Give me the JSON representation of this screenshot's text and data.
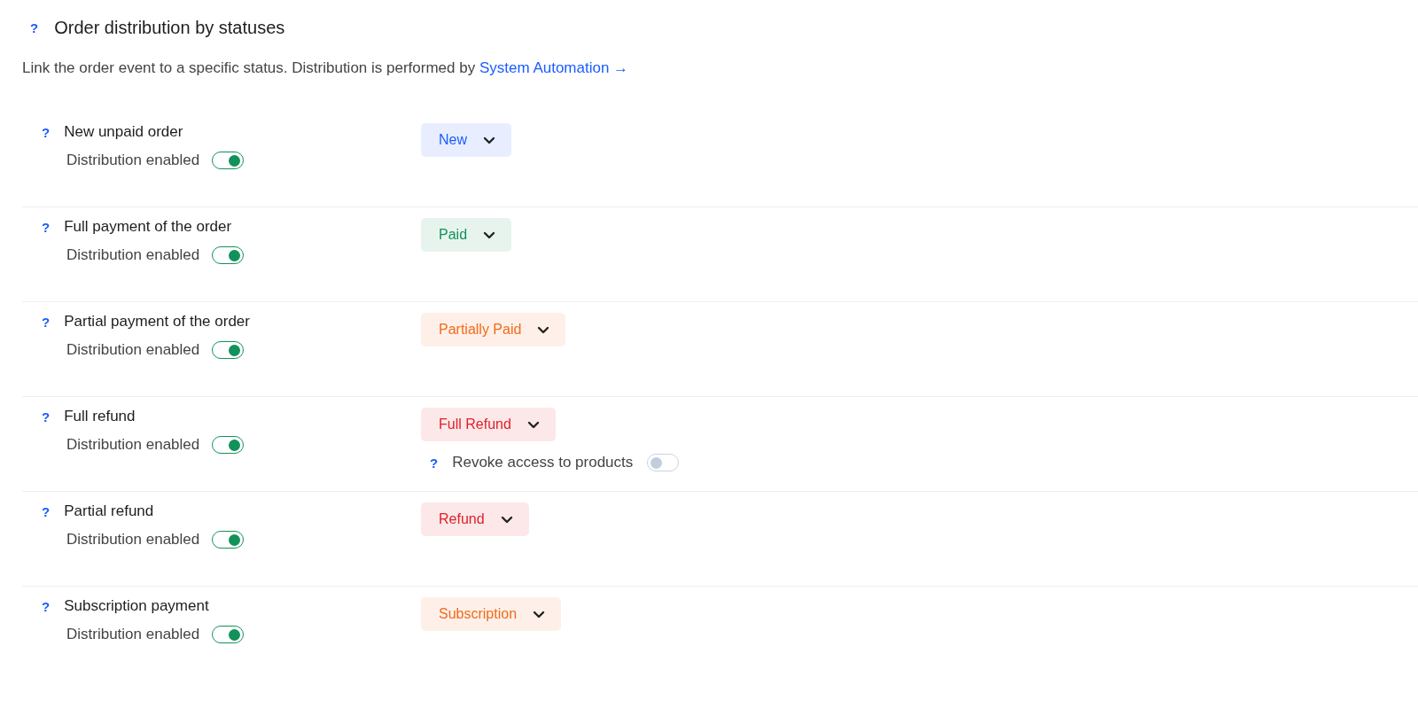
{
  "section": {
    "help": "?",
    "title": "Order distribution by statuses",
    "description": "Link the order event to a specific status. Distribution is performed by ",
    "link": "System Automation →"
  },
  "events": [
    {
      "help": "?",
      "name": "New unpaid order",
      "toggle_label": "Distribution enabled",
      "on": true,
      "status": "New",
      "color": "#1a5cff"
    },
    {
      "help": "?",
      "name": "Full payment of the order",
      "toggle_label": "Distribution enabled",
      "on": true,
      "status": "Paid",
      "color": "#12915a"
    },
    {
      "help": "?",
      "name": "Partial payment of the order",
      "toggle_label": "Distribution enabled",
      "on": true,
      "status": "Partially Paid",
      "color": "#f26a1b"
    },
    {
      "help": "?",
      "name": "Full refund",
      "toggle_label": "Distribution enabled",
      "on": true,
      "status": "Full Refund",
      "color": "#e0202a",
      "option": {
        "help": "?",
        "label": "Revoke access to products",
        "on": false
      }
    },
    {
      "help": "?",
      "name": "Partial refund",
      "toggle_label": "Distribution enabled",
      "on": true,
      "status": "Refund",
      "color": "#e0202a"
    },
    {
      "help": "?",
      "name": "Subscription payment",
      "toggle_label": "Distribution enabled",
      "on": true,
      "status": "Subscription",
      "color": "#f26a1b"
    }
  ]
}
